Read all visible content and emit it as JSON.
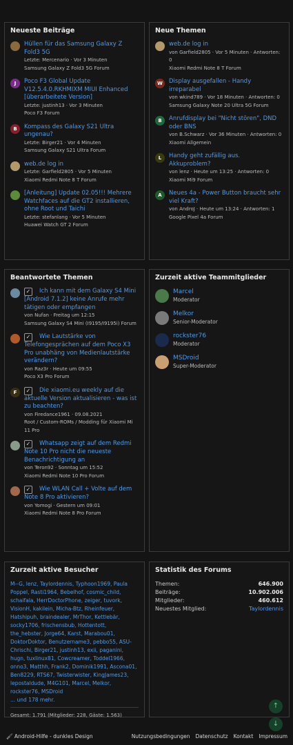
{
  "newest_posts": {
    "title": "Neueste Beiträge",
    "items": [
      {
        "av": "",
        "avcolor": "#8a6a3a",
        "title": "Hüllen für das Samsung Galaxy Z Fold3 5G",
        "meta": "Letzte: Mercenario · Vor 3 Minuten",
        "forum": "Samsung Galaxy Z Fold3 5G Forum"
      },
      {
        "av": "J",
        "avcolor": "#7a2d8a",
        "title": "Poco F3 Global Update V12.5.4.0.RKHMIXM MIUI Enhanced [überarbeitete Version]",
        "meta": "Letzte: justinh13 · Vor 3 Minuten",
        "forum": "Poco F3 Forum"
      },
      {
        "av": "B",
        "avcolor": "#8a1f2a",
        "title": "Kompass des Galaxy S21 Ultra ungenau?",
        "meta": "Letzte: Birger21 · Vor 4 Minuten",
        "forum": "Samsung Galaxy S21 Ultra Forum"
      },
      {
        "av": "",
        "avcolor": "#b49a6a",
        "title": "web.de log in",
        "meta": "Letzte: Garfield2805 · Vor 5 Minuten",
        "forum": "Xiaomi Redmi Note 8 T Forum"
      },
      {
        "av": "",
        "avcolor": "#5a8a3a",
        "title": "[Anleitung] Update 02.05!!! Mehrere Watchfaces auf die GT2 installieren, ohne Root und Taichi",
        "meta": "Letzte: stefanlang · Vor 5 Minuten",
        "forum": "Huawei Watch GT 2 Forum"
      }
    ]
  },
  "new_threads": {
    "title": "Neue Themen",
    "items": [
      {
        "av": "",
        "avcolor": "#b49a6a",
        "title": "web.de log in",
        "meta": "von Garfield2805 · Vor 5 Minuten · Antworten: 0",
        "forum": "Xiaomi Redmi Note 8 T Forum"
      },
      {
        "av": "W",
        "avcolor": "#7a2a1a",
        "title": "Display ausgefallen - Handy irreparabel",
        "meta": "von wkind789 · Vor 18 Minuten · Antworten: 0",
        "forum": "Samsung Galaxy Note 20 Ultra 5G Forum"
      },
      {
        "av": "B",
        "avcolor": "#1f6a3a",
        "title": "Anrufdisplay bei \"Nicht stören\", DND oder BNS",
        "meta": "von B.Schwarz · Vor 36 Minuten · Antworten: 0",
        "forum": "Xiaomi Allgemein"
      },
      {
        "av": "L",
        "avcolor": "#3a3a10",
        "title": "Handy geht zufällig aus. Akkuproblem?",
        "meta": "von lenz · Heute um 13:25 · Antworten: 0",
        "forum": "Xiaomi Mi9 Forum"
      },
      {
        "av": "A",
        "avcolor": "#1f5a2a",
        "title": "Neues 4a - Power Button braucht sehr viel Kraft?",
        "meta": "von AndroJ · Heute um 13:24 · Antworten: 1",
        "forum": "Google Pixel 4a Forum"
      }
    ]
  },
  "answered": {
    "title": "Beantwortete Themen",
    "items": [
      {
        "av": "",
        "avcolor": "#6a8aa0",
        "title": "Ich kann mit dem Galaxy S4 Mini [Android 7.1.2] keine Anrufe mehr tätigen oder empfangen",
        "meta": "von Nufan · Freitag um 12:15",
        "forum": "Samsung Galaxy S4 Mini (I9195/I9195i) Forum"
      },
      {
        "av": "",
        "avcolor": "#b05a2a",
        "title": "Wie Lautstärke von Telefongesprächen auf dem Poco X3 Pro unabhäng von Medienlautstärke verändern?",
        "meta": "von Raz3r · Heute um 09:55",
        "forum": "Poco X3 Pro Forum"
      },
      {
        "av": "F",
        "avcolor": "#3a3010",
        "title": "Die xiaomi.eu weekly auf die aktuelle Version aktualisieren - was ist zu beachten?",
        "meta": "von Firedance1961 · 09.08.2021",
        "forum": "Root / Custom-ROMs / Modding für Xiaomi Mi 11 Pro"
      },
      {
        "av": "",
        "avcolor": "#8a9a8a",
        "title": "Whatsapp zeigt auf dem Redmi Note 10 Pro nicht die neueste Benachrichtigung an",
        "meta": "von Teron92 · Sonntag um 15:52",
        "forum": "Xiaomi Redmi Note 10 Pro Forum"
      },
      {
        "av": "",
        "avcolor": "#a06a4a",
        "title": "Wie WLAN Call + Volte auf dem Note 8 Pro aktivieren?",
        "meta": "von Yomogi · Gestern um 09:01",
        "forum": "Xiaomi Redmi Note 8 Pro Forum"
      }
    ]
  },
  "team": {
    "title": "Zurzeit aktive Teammitglieder",
    "items": [
      {
        "name": "Marcel",
        "role": "Moderator",
        "avcolor": "#4a7a4a"
      },
      {
        "name": "Melkor",
        "role": "Senior-Moderator",
        "avcolor": "#7a7a7a"
      },
      {
        "name": "rockster76",
        "role": "Moderator",
        "avcolor": "#1a2a4a"
      },
      {
        "name": "MSDroid",
        "role": "Super-Moderator",
        "avcolor": "#caa070"
      }
    ]
  },
  "visitors": {
    "title": "Zurzeit aktive Besucher",
    "names": [
      "M--G",
      "lenz",
      "Taylordennis",
      "Typhoon1969",
      "Paula Poppel",
      "Rasti1964",
      "Bebelhof",
      "cosmic_child",
      "schaifala",
      "HerrDoctorPhone",
      "zeiger",
      "tuvork",
      "VisionH",
      "kakilein",
      "Micha-Btz",
      "Rheinfeuer",
      "Hatshipuh",
      "braindealer",
      "MrThor",
      "Kettlebär",
      "socky1706",
      "frischensbub",
      "Hottentott",
      "the_hebster",
      "Jorge64",
      "Karst",
      "Marabou01",
      "DoktorDoktor",
      "Benutzername3",
      "pebbo55",
      "ASU-Chrischi",
      "Birger21",
      "justinh13",
      "exii",
      "paganini",
      "hugn",
      "tuxlinux81",
      "Cowcreamer",
      "Toddel1966",
      "onno3",
      "Matthh",
      "Frank2",
      "Dominik1991",
      "Ascona01",
      "Ben8229",
      "RTS67",
      "Twisterwister",
      "KingJames23",
      "lepostaldude",
      "M4G101",
      "Marcel",
      "Melkor",
      "rockster76",
      "MSDroid"
    ],
    "more": "... und 178 mehr.",
    "total": "Gesamt: 1.791 (Mitglieder: 228, Gäste: 1.563)"
  },
  "stats": {
    "title": "Statistik des Forums",
    "rows": [
      {
        "label": "Themen:",
        "value": "646.900"
      },
      {
        "label": "Beiträge:",
        "value": "10.902.006"
      },
      {
        "label": "Mitglieder:",
        "value": "460.612"
      },
      {
        "label": "Neuestes Mitglied:",
        "value": "Taylordennis"
      }
    ]
  },
  "footer": {
    "style": "Android-Hilfe - dunkles Design",
    "links": [
      "Nutzungsbedingungen",
      "Datenschutz",
      "Kontakt",
      "Impressum"
    ]
  },
  "scroll_up": "↑",
  "scroll_down": "↓"
}
